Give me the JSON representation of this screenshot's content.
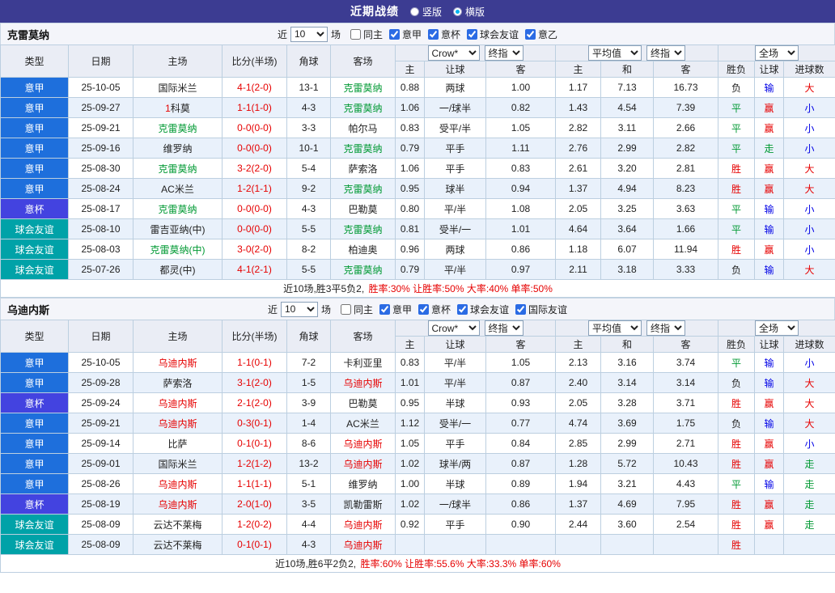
{
  "topbar": {
    "title": "近期战绩",
    "radio_vertical": "竖版",
    "radio_horizontal": "横版"
  },
  "filters": {
    "near_label": "近",
    "count": "10",
    "games_label": "场"
  },
  "table_headers": {
    "type": "类型",
    "date": "日期",
    "home": "主场",
    "score": "比分(半场)",
    "corner": "角球",
    "away": "客场",
    "odds_company_select": "Crow*",
    "final_odds_select": "终指",
    "avg_select": "平均值",
    "avg_final_select": "终指",
    "full_select": "全场",
    "sub": [
      "主",
      "让球",
      "客",
      "主",
      "和",
      "客",
      "胜负",
      "让球",
      "进球数"
    ]
  },
  "sections": [
    {
      "team": "克雷莫纳",
      "checkboxes": [
        {
          "label": "同主",
          "checked": false
        },
        {
          "label": "意甲",
          "checked": true
        },
        {
          "label": "意杯",
          "checked": true
        },
        {
          "label": "球会友谊",
          "checked": true
        },
        {
          "label": "意乙",
          "checked": true
        }
      ],
      "rows": [
        {
          "lg": "意甲",
          "lgc": "lg-a",
          "date": "25-10-05",
          "home": {
            "n": "国际米兰",
            "c": "k"
          },
          "score": "4-1(2-0)",
          "corner": "13-1",
          "away": {
            "n": "克雷莫纳",
            "c": "g"
          },
          "odds": [
            "0.88",
            "两球",
            "1.00",
            "1.17",
            "7.13",
            "16.73"
          ],
          "res": [
            [
              "负",
              "k"
            ],
            [
              "输",
              "b"
            ],
            [
              "大",
              "r"
            ]
          ]
        },
        {
          "lg": "意甲",
          "lgc": "lg-a",
          "date": "25-09-27",
          "home": {
            "n": "科莫",
            "c": "k",
            "rank": "1"
          },
          "score": "1-1(1-0)",
          "corner": "4-3",
          "away": {
            "n": "克雷莫纳",
            "c": "g"
          },
          "odds": [
            "1.06",
            "一/球半",
            "0.82",
            "1.43",
            "4.54",
            "7.39"
          ],
          "res": [
            [
              "平",
              "g"
            ],
            [
              "赢",
              "r"
            ],
            [
              "小",
              "b"
            ]
          ]
        },
        {
          "lg": "意甲",
          "lgc": "lg-a",
          "date": "25-09-21",
          "home": {
            "n": "克雷莫纳",
            "c": "g"
          },
          "score": "0-0(0-0)",
          "corner": "3-3",
          "away": {
            "n": "帕尔马",
            "c": "k"
          },
          "odds": [
            "0.83",
            "受平/半",
            "1.05",
            "2.82",
            "3.11",
            "2.66"
          ],
          "res": [
            [
              "平",
              "g"
            ],
            [
              "赢",
              "r"
            ],
            [
              "小",
              "b"
            ]
          ]
        },
        {
          "lg": "意甲",
          "lgc": "lg-a",
          "date": "25-09-16",
          "home": {
            "n": "维罗纳",
            "c": "k"
          },
          "score": "0-0(0-0)",
          "corner": "10-1",
          "away": {
            "n": "克雷莫纳",
            "c": "g"
          },
          "odds": [
            "0.79",
            "平手",
            "1.11",
            "2.76",
            "2.99",
            "2.82"
          ],
          "res": [
            [
              "平",
              "g"
            ],
            [
              "走",
              "g"
            ],
            [
              "小",
              "b"
            ]
          ]
        },
        {
          "lg": "意甲",
          "lgc": "lg-a",
          "date": "25-08-30",
          "home": {
            "n": "克雷莫纳",
            "c": "g"
          },
          "score": "3-2(2-0)",
          "corner": "5-4",
          "away": {
            "n": "萨索洛",
            "c": "k"
          },
          "odds": [
            "1.06",
            "平手",
            "0.83",
            "2.61",
            "3.20",
            "2.81"
          ],
          "res": [
            [
              "胜",
              "r"
            ],
            [
              "赢",
              "r"
            ],
            [
              "大",
              "r"
            ]
          ]
        },
        {
          "lg": "意甲",
          "lgc": "lg-a",
          "date": "25-08-24",
          "home": {
            "n": "AC米兰",
            "c": "k"
          },
          "score": "1-2(1-1)",
          "corner": "9-2",
          "away": {
            "n": "克雷莫纳",
            "c": "g"
          },
          "odds": [
            "0.95",
            "球半",
            "0.94",
            "1.37",
            "4.94",
            "8.23"
          ],
          "res": [
            [
              "胜",
              "r"
            ],
            [
              "赢",
              "r"
            ],
            [
              "大",
              "r"
            ]
          ]
        },
        {
          "lg": "意杯",
          "lgc": "lg-cup",
          "date": "25-08-17",
          "home": {
            "n": "克雷莫纳",
            "c": "g"
          },
          "score": "0-0(0-0)",
          "corner": "4-3",
          "away": {
            "n": "巴勒莫",
            "c": "k"
          },
          "odds": [
            "0.80",
            "平/半",
            "1.08",
            "2.05",
            "3.25",
            "3.63"
          ],
          "res": [
            [
              "平",
              "g"
            ],
            [
              "输",
              "b"
            ],
            [
              "小",
              "b"
            ]
          ]
        },
        {
          "lg": "球会友谊",
          "lgc": "lg-fr",
          "date": "25-08-10",
          "home": {
            "n": "雷吉亚纳(中)",
            "c": "k"
          },
          "score": "0-0(0-0)",
          "corner": "5-5",
          "away": {
            "n": "克雷莫纳",
            "c": "g"
          },
          "odds": [
            "0.81",
            "受半/一",
            "1.01",
            "4.64",
            "3.64",
            "1.66"
          ],
          "res": [
            [
              "平",
              "g"
            ],
            [
              "输",
              "b"
            ],
            [
              "小",
              "b"
            ]
          ]
        },
        {
          "lg": "球会友谊",
          "lgc": "lg-fr",
          "date": "25-08-03",
          "home": {
            "n": "克雷莫纳(中)",
            "c": "g"
          },
          "score": "3-0(2-0)",
          "corner": "8-2",
          "away": {
            "n": "柏迪奥",
            "c": "k"
          },
          "odds": [
            "0.96",
            "两球",
            "0.86",
            "1.18",
            "6.07",
            "11.94"
          ],
          "res": [
            [
              "胜",
              "r"
            ],
            [
              "赢",
              "r"
            ],
            [
              "小",
              "b"
            ]
          ]
        },
        {
          "lg": "球会友谊",
          "lgc": "lg-fr",
          "date": "25-07-26",
          "home": {
            "n": "都灵(中)",
            "c": "k"
          },
          "score": "4-1(2-1)",
          "corner": "5-5",
          "away": {
            "n": "克雷莫纳",
            "c": "g"
          },
          "odds": [
            "0.79",
            "平/半",
            "0.97",
            "2.11",
            "3.18",
            "3.33"
          ],
          "res": [
            [
              "负",
              "k"
            ],
            [
              "输",
              "b"
            ],
            [
              "大",
              "r"
            ]
          ]
        }
      ],
      "summary_plain": "近10场,胜3平5负2, ",
      "summary_red": "胜率:30% 让胜率:50% 大率:40% 单率:50%"
    },
    {
      "team": "乌迪内斯",
      "checkboxes": [
        {
          "label": "同主",
          "checked": false
        },
        {
          "label": "意甲",
          "checked": true
        },
        {
          "label": "意杯",
          "checked": true
        },
        {
          "label": "球会友谊",
          "checked": true
        },
        {
          "label": "国际友谊",
          "checked": true
        }
      ],
      "rows": [
        {
          "lg": "意甲",
          "lgc": "lg-a",
          "date": "25-10-05",
          "home": {
            "n": "乌迪内斯",
            "c": "r"
          },
          "score": "1-1(0-1)",
          "corner": "7-2",
          "away": {
            "n": "卡利亚里",
            "c": "k"
          },
          "odds": [
            "0.83",
            "平/半",
            "1.05",
            "2.13",
            "3.16",
            "3.74"
          ],
          "res": [
            [
              "平",
              "g"
            ],
            [
              "输",
              "b"
            ],
            [
              "小",
              "b"
            ]
          ]
        },
        {
          "lg": "意甲",
          "lgc": "lg-a",
          "date": "25-09-28",
          "home": {
            "n": "萨索洛",
            "c": "k"
          },
          "score": "3-1(2-0)",
          "corner": "1-5",
          "away": {
            "n": "乌迪内斯",
            "c": "r"
          },
          "odds": [
            "1.01",
            "平/半",
            "0.87",
            "2.40",
            "3.14",
            "3.14"
          ],
          "res": [
            [
              "负",
              "k"
            ],
            [
              "输",
              "b"
            ],
            [
              "大",
              "r"
            ]
          ]
        },
        {
          "lg": "意杯",
          "lgc": "lg-cup",
          "date": "25-09-24",
          "home": {
            "n": "乌迪内斯",
            "c": "r"
          },
          "score": "2-1(2-0)",
          "corner": "3-9",
          "away": {
            "n": "巴勒莫",
            "c": "k"
          },
          "odds": [
            "0.95",
            "半球",
            "0.93",
            "2.05",
            "3.28",
            "3.71"
          ],
          "res": [
            [
              "胜",
              "r"
            ],
            [
              "赢",
              "r"
            ],
            [
              "大",
              "r"
            ]
          ]
        },
        {
          "lg": "意甲",
          "lgc": "lg-a",
          "date": "25-09-21",
          "home": {
            "n": "乌迪内斯",
            "c": "r"
          },
          "score": "0-3(0-1)",
          "corner": "1-4",
          "away": {
            "n": "AC米兰",
            "c": "k"
          },
          "odds": [
            "1.12",
            "受半/一",
            "0.77",
            "4.74",
            "3.69",
            "1.75"
          ],
          "res": [
            [
              "负",
              "k"
            ],
            [
              "输",
              "b"
            ],
            [
              "大",
              "r"
            ]
          ]
        },
        {
          "lg": "意甲",
          "lgc": "lg-a",
          "date": "25-09-14",
          "home": {
            "n": "比萨",
            "c": "k"
          },
          "score": "0-1(0-1)",
          "corner": "8-6",
          "away": {
            "n": "乌迪内斯",
            "c": "r"
          },
          "odds": [
            "1.05",
            "平手",
            "0.84",
            "2.85",
            "2.99",
            "2.71"
          ],
          "res": [
            [
              "胜",
              "r"
            ],
            [
              "赢",
              "r"
            ],
            [
              "小",
              "b"
            ]
          ]
        },
        {
          "lg": "意甲",
          "lgc": "lg-a",
          "date": "25-09-01",
          "home": {
            "n": "国际米兰",
            "c": "k"
          },
          "score": "1-2(1-2)",
          "corner": "13-2",
          "away": {
            "n": "乌迪内斯",
            "c": "r"
          },
          "odds": [
            "1.02",
            "球半/两",
            "0.87",
            "1.28",
            "5.72",
            "10.43"
          ],
          "res": [
            [
              "胜",
              "r"
            ],
            [
              "赢",
              "r"
            ],
            [
              "走",
              "g"
            ]
          ]
        },
        {
          "lg": "意甲",
          "lgc": "lg-a",
          "date": "25-08-26",
          "home": {
            "n": "乌迪内斯",
            "c": "r"
          },
          "score": "1-1(1-1)",
          "corner": "5-1",
          "away": {
            "n": "维罗纳",
            "c": "k"
          },
          "odds": [
            "1.00",
            "半球",
            "0.89",
            "1.94",
            "3.21",
            "4.43"
          ],
          "res": [
            [
              "平",
              "g"
            ],
            [
              "输",
              "b"
            ],
            [
              "走",
              "g"
            ]
          ]
        },
        {
          "lg": "意杯",
          "lgc": "lg-cup",
          "date": "25-08-19",
          "home": {
            "n": "乌迪内斯",
            "c": "r"
          },
          "score": "2-0(1-0)",
          "corner": "3-5",
          "away": {
            "n": "凯勒雷斯",
            "c": "k"
          },
          "odds": [
            "1.02",
            "一/球半",
            "0.86",
            "1.37",
            "4.69",
            "7.95"
          ],
          "res": [
            [
              "胜",
              "r"
            ],
            [
              "赢",
              "r"
            ],
            [
              "走",
              "g"
            ]
          ]
        },
        {
          "lg": "球会友谊",
          "lgc": "lg-fr",
          "date": "25-08-09",
          "home": {
            "n": "云达不莱梅",
            "c": "k"
          },
          "score": "1-2(0-2)",
          "corner": "4-4",
          "away": {
            "n": "乌迪内斯",
            "c": "r"
          },
          "odds": [
            "0.92",
            "平手",
            "0.90",
            "2.44",
            "3.60",
            "2.54"
          ],
          "res": [
            [
              "胜",
              "r"
            ],
            [
              "赢",
              "r"
            ],
            [
              "走",
              "g"
            ]
          ]
        },
        {
          "lg": "球会友谊",
          "lgc": "lg-fr",
          "date": "25-08-09",
          "home": {
            "n": "云达不莱梅",
            "c": "k"
          },
          "score": "0-1(0-1)",
          "corner": "4-3",
          "away": {
            "n": "乌迪内斯",
            "c": "r"
          },
          "odds": [
            "",
            "",
            "",
            "",
            "",
            ""
          ],
          "res": [
            [
              "胜",
              "r"
            ],
            [
              "",
              ""
            ],
            [
              "",
              ""
            ]
          ]
        }
      ],
      "summary_plain": "近10场,胜6平2负2, ",
      "summary_red": "胜率:60% 让胜率:55.6% 大率:33.3% 单率:60%"
    }
  ]
}
